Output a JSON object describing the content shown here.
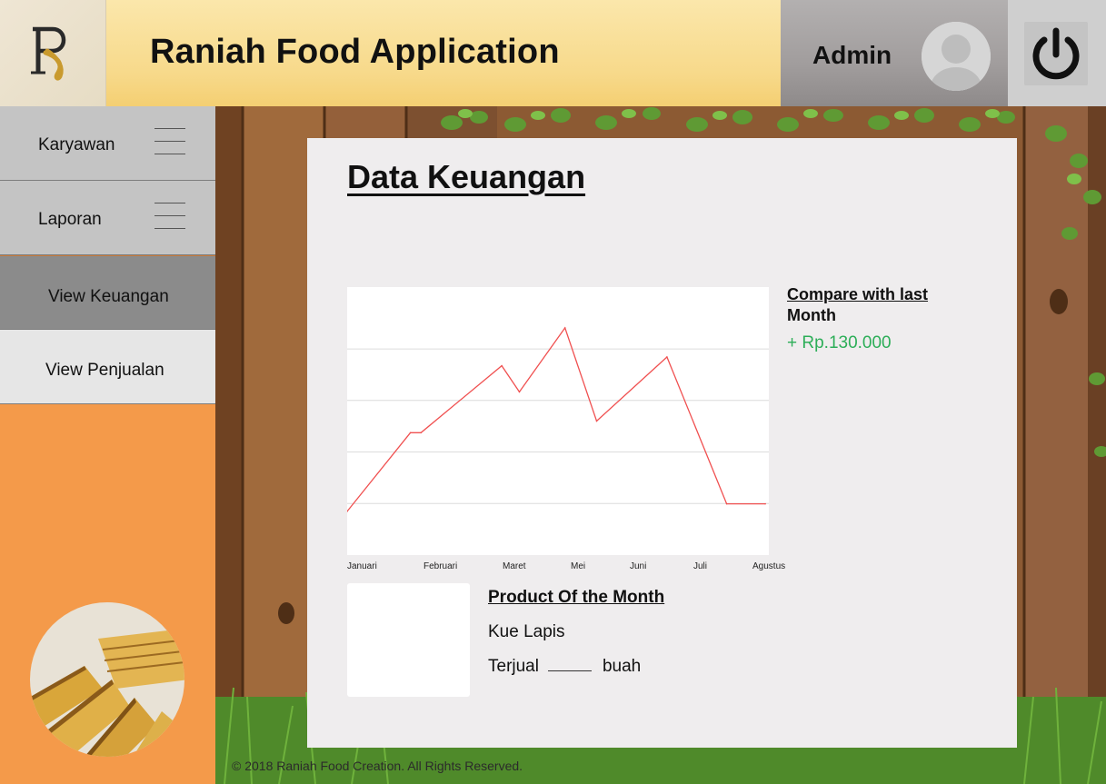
{
  "header": {
    "app_title": "Raniah Food Application",
    "user_label": "Admin",
    "logo_icon": "raniah-r-logo-icon",
    "avatar_icon": "user-avatar-icon",
    "power_icon": "power-icon"
  },
  "sidebar": {
    "items": [
      {
        "label": "Karyawan",
        "icon": "hamburger-menu-icon"
      },
      {
        "label": "Laporan",
        "icon": "hamburger-menu-icon"
      },
      {
        "label": "View Keuangan",
        "active": true
      },
      {
        "label": "View Penjualan"
      }
    ],
    "accent_color": "#f49a4a"
  },
  "main": {
    "page_title": "Data Keuangan",
    "compare": {
      "title_line1": "Compare with last",
      "title_line2": "Month",
      "value": "+ Rp.130.000",
      "value_color": "#2dae58"
    },
    "product_of_month": {
      "title": "Product Of the Month",
      "name": "Kue Lapis",
      "sold_prefix": "Terjual",
      "sold_suffix": "buah"
    }
  },
  "chart_data": {
    "type": "line",
    "categories": [
      "Januari",
      "Februari",
      "Maret",
      "Mei",
      "Juni",
      "Juli",
      "Agustus"
    ],
    "x": [
      0,
      0.9,
      1.05,
      2.2,
      2.45,
      3.1,
      3.55,
      4.55,
      5.4,
      5.95
    ],
    "values": [
      0.75,
      2.1,
      2.1,
      3.25,
      2.8,
      3.9,
      2.3,
      3.4,
      0.88,
      0.88
    ],
    "line_color": "#f05050",
    "grid": true,
    "ylim": [
      0,
      4.6
    ]
  },
  "footer": {
    "copyright": "© 2018 Raniah Food Creation. All Rights Reserved."
  }
}
